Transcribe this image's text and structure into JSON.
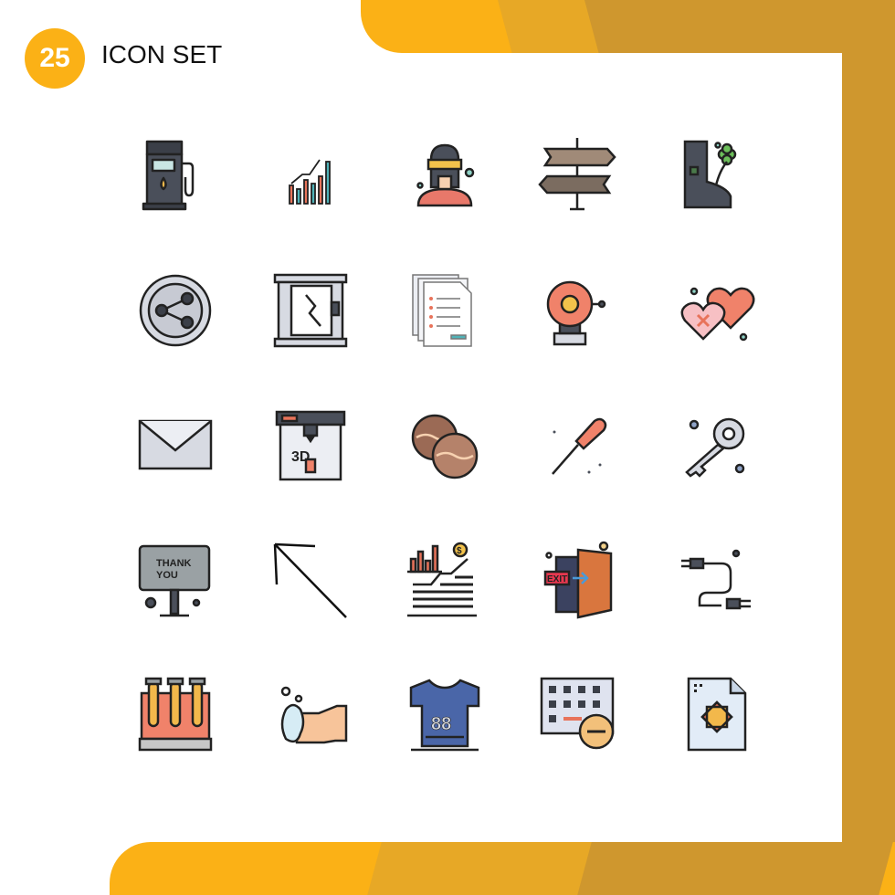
{
  "header": {
    "badge": "25",
    "title": "ICON SET"
  },
  "colors": {
    "accent": "#FBB116",
    "accent_mid": "#E7A826",
    "accent_dark": "#CF972E",
    "stroke": "#222222"
  },
  "icons": [
    {
      "name": "fuel-pump-icon"
    },
    {
      "name": "bar-chart-growth-icon"
    },
    {
      "name": "vr-headset-person-icon"
    },
    {
      "name": "direction-signpost-icon"
    },
    {
      "name": "boot-clover-icon"
    },
    {
      "name": "share-circle-icon"
    },
    {
      "name": "broken-glass-door-icon"
    },
    {
      "name": "checklist-documents-icon"
    },
    {
      "name": "alarm-bell-icon"
    },
    {
      "name": "broken-hearts-icon"
    },
    {
      "name": "envelope-icon"
    },
    {
      "name": "3d-printer-icon"
    },
    {
      "name": "cookies-icon"
    },
    {
      "name": "screwdriver-icon"
    },
    {
      "name": "key-icon"
    },
    {
      "name": "thank-you-sign-icon",
      "label": "THANK YOU",
      "label1": "THANK",
      "label2": "YOU"
    },
    {
      "name": "arrow-up-left-icon"
    },
    {
      "name": "financial-growth-icon",
      "label": "$"
    },
    {
      "name": "exit-door-icon",
      "label": "EXIT"
    },
    {
      "name": "cable-connector-icon"
    },
    {
      "name": "test-tubes-icon"
    },
    {
      "name": "hand-washing-icon"
    },
    {
      "name": "jersey-shirt-icon",
      "label": "88"
    },
    {
      "name": "keyboard-remove-icon"
    },
    {
      "name": "design-file-icon"
    }
  ],
  "printer_label": "3D"
}
